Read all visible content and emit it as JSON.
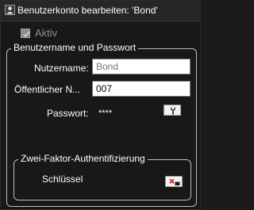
{
  "window": {
    "title": "Benutzerkonto bearbeiten: 'Bond'",
    "icon": "user-edit-icon"
  },
  "aktiv": {
    "label": "Aktiv",
    "checked": true,
    "disabled": true
  },
  "credentials": {
    "legend": "Benutzername und Passwort",
    "username_label": "Nutzername:",
    "username_placeholder": "Bond",
    "username_value": "",
    "public_name_label": "Öffentlicher N...",
    "public_name_value": "007",
    "password_label": "Passwort:",
    "password_value": "****",
    "password_button_icon": "wrench-icon"
  },
  "two_factor": {
    "legend": "Zwei-Faktor-Authentifizierung",
    "key_label": "Schlüssel",
    "key_button_icon": "key-remove-icon"
  },
  "colors": {
    "background": "#181818",
    "titlebar": "#262626",
    "disabled_text": "#8e8e8e",
    "group_border": "#bdbdbd",
    "remove_red": "#d81e1e"
  }
}
